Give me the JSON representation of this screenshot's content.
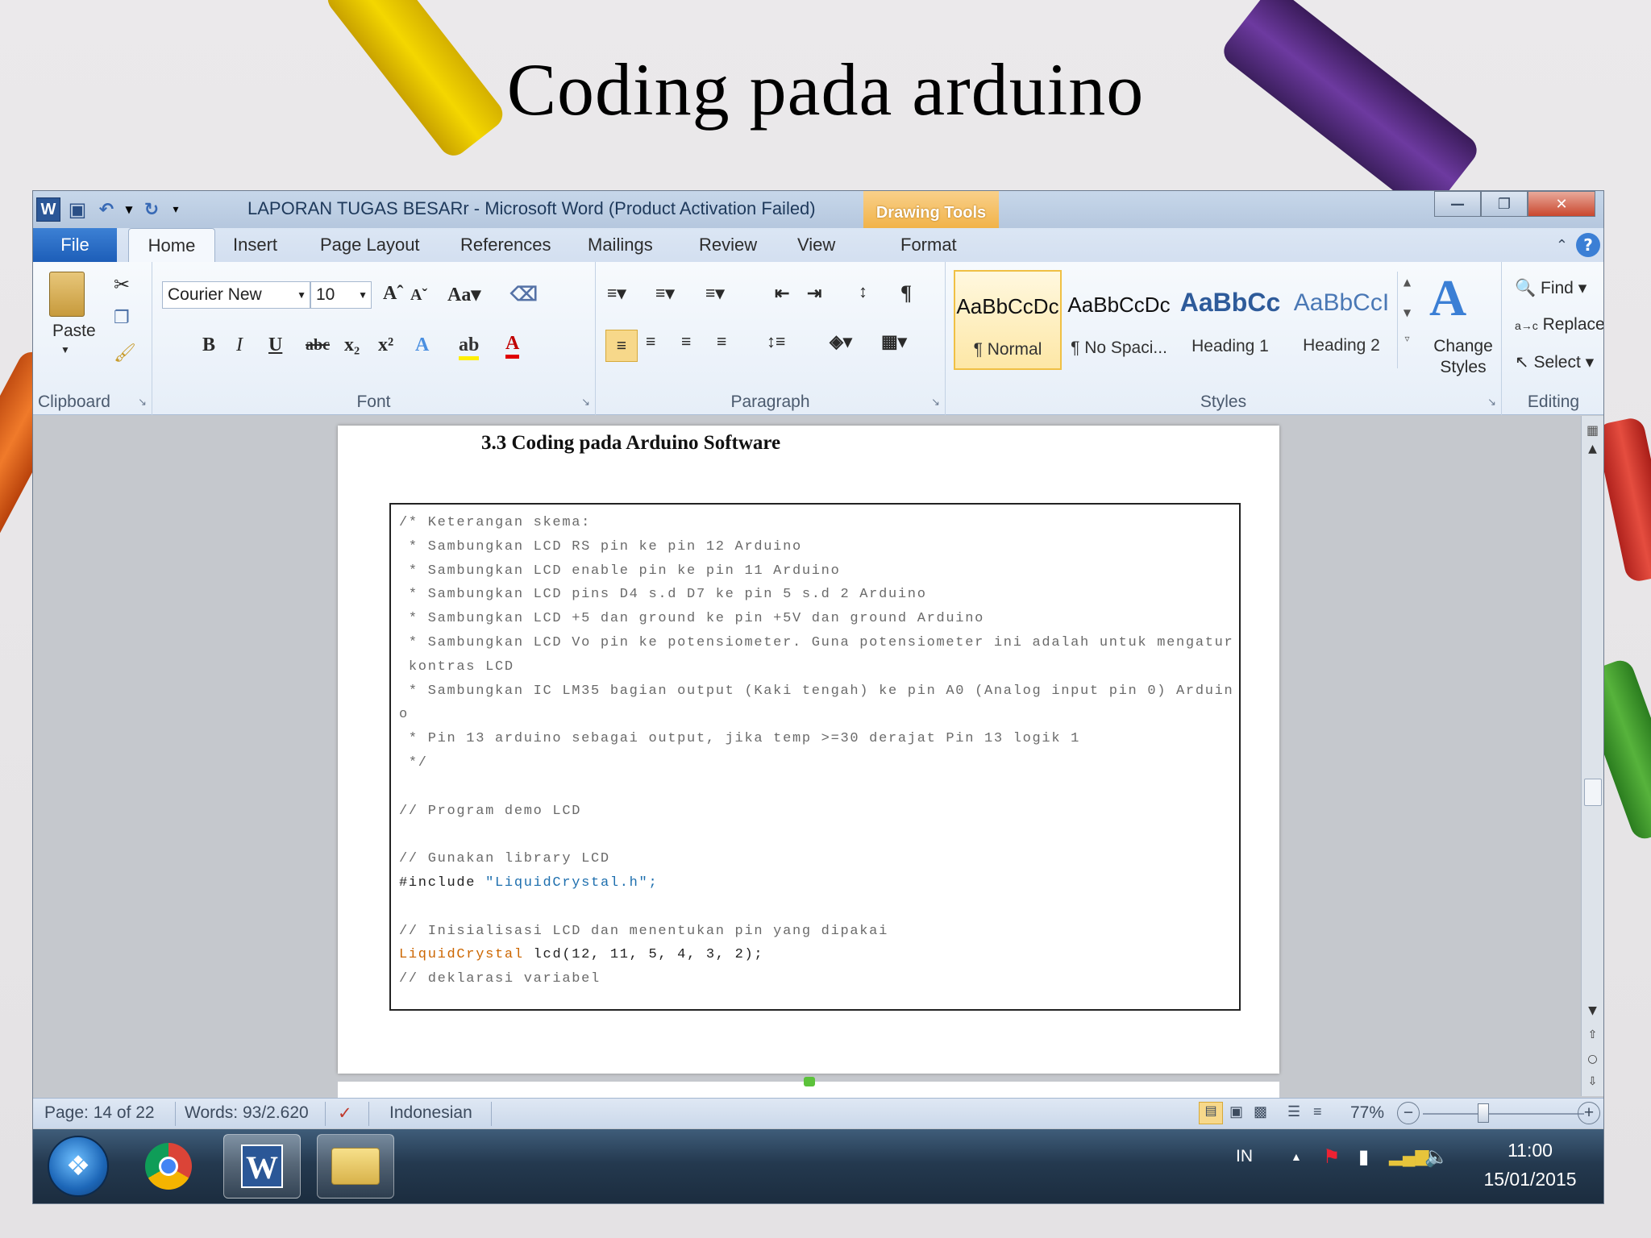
{
  "slide": {
    "title": "Coding pada arduino"
  },
  "window": {
    "title": "LAPORAN TUGAS BESARr  -  Microsoft Word (Product Activation Failed)",
    "contextual_tab": "Drawing Tools"
  },
  "tabs": {
    "file": "File",
    "home": "Home",
    "insert": "Insert",
    "page_layout": "Page Layout",
    "references": "References",
    "mailings": "Mailings",
    "review": "Review",
    "view": "View",
    "format": "Format"
  },
  "ribbon": {
    "clipboard": {
      "paste": "Paste",
      "label": "Clipboard"
    },
    "font": {
      "name": "Courier New",
      "size": "10",
      "label": "Font"
    },
    "paragraph": {
      "label": "Paragraph"
    },
    "styles": {
      "label": "Styles",
      "items": [
        {
          "sample": "AaBbCcDc",
          "name": "¶ Normal"
        },
        {
          "sample": "AaBbCcDc",
          "name": "¶ No Spaci..."
        },
        {
          "sample": "AaBbCc",
          "name": "Heading 1"
        },
        {
          "sample": "AaBbCcI",
          "name": "Heading 2"
        }
      ],
      "change_styles": "Change Styles"
    },
    "editing": {
      "find": "Find",
      "replace": "Replace",
      "select": "Select",
      "label": "Editing"
    }
  },
  "document": {
    "heading": "3.3 Coding pada Arduino Software",
    "code": [
      "/* Keterangan skema:",
      " * Sambungkan LCD RS pin ke pin 12 Arduino",
      " * Sambungkan LCD enable pin ke pin 11 Arduino",
      " * Sambungkan LCD pins D4 s.d D7 ke pin 5 s.d 2 Arduino",
      " * Sambungkan LCD +5 dan ground ke pin +5V dan ground Arduino",
      " * Sambungkan LCD Vo pin ke potensiometer. Guna potensiometer ini adalah untuk mengatur",
      " kontras LCD",
      " * Sambungkan IC LM35 bagian output (Kaki tengah) ke pin A0 (Analog input pin 0) Arduin",
      "o",
      " * Pin 13 arduino sebagai output, jika temp >=30 derajat Pin 13 logik 1",
      " */",
      "",
      "// Program demo LCD",
      "",
      "// Gunakan library LCD",
      "",
      "",
      "// Inisialisasi LCD dan menentukan pin yang dipakai",
      "",
      "// deklarasi variabel"
    ],
    "include_keyword": "#include ",
    "include_value": "\"LiquidCrystal.h\";",
    "lcd_class": "LiquidCrystal",
    "lcd_args": " lcd(12, 11, 5, 4, 3, 2);"
  },
  "statusbar": {
    "page": "Page: 14 of 22",
    "words": "Words: 93/2.620",
    "language": "Indonesian",
    "zoom": "77%"
  },
  "taskbar": {
    "lang": "IN",
    "time": "11:00",
    "date": "15/01/2015"
  }
}
